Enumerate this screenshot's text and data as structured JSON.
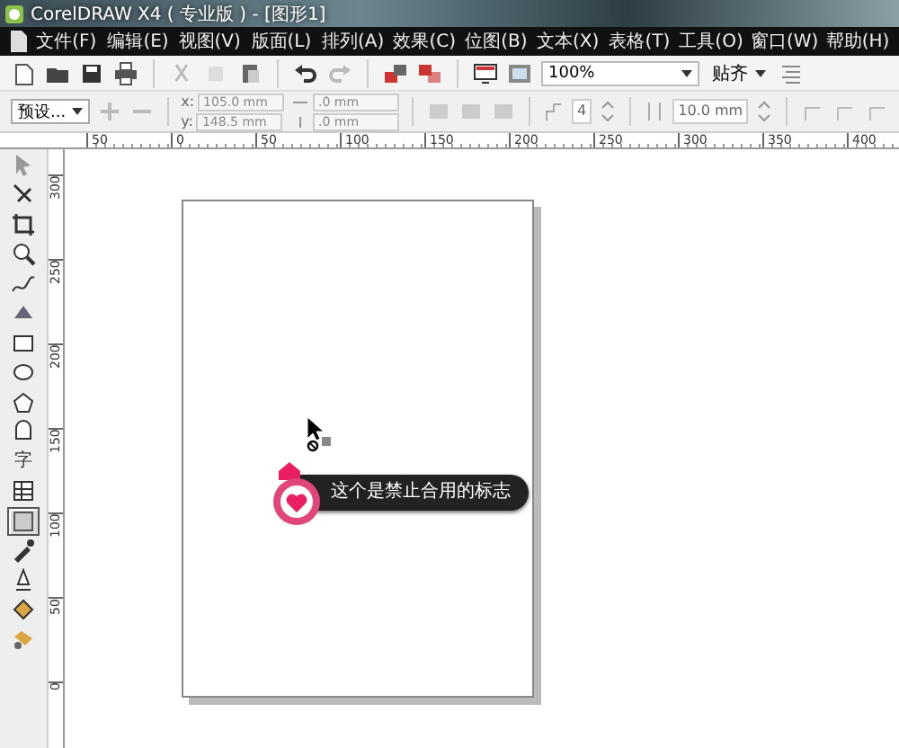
{
  "window": {
    "title": "CorelDRAW X4 ( 专业版 ) - [图形1]"
  },
  "menu": [
    "文件(F)",
    "编辑(E)",
    "视图(V)",
    "版面(L)",
    "排列(A)",
    "效果(C)",
    "位图(B)",
    "文本(X)",
    "表格(T)",
    "工具(O)",
    "窗口(W)",
    "帮助(H)"
  ],
  "toolbar": {
    "zoom": "100%",
    "snap": "贴齐"
  },
  "property_bar": {
    "preset": "预设...",
    "x_label": "x:",
    "x": "105.0 mm",
    "y_label": "y:",
    "y": "148.5 mm",
    "width": ".0 mm",
    "height": ".0 mm",
    "count": "4",
    "spacing": "10.0 mm"
  },
  "ruler": {
    "horizontal": [
      "50",
      "0",
      "50",
      "100",
      "150",
      "200",
      "250",
      "300",
      "350",
      "400"
    ],
    "vertical": [
      "300",
      "250",
      "200",
      "150",
      "100",
      "50",
      "0"
    ]
  },
  "toolbox": [
    {
      "kind": "pick",
      "selected": false
    },
    {
      "kind": "shape",
      "selected": false
    },
    {
      "kind": "crop",
      "selected": false
    },
    {
      "kind": "zoom",
      "selected": false
    },
    {
      "kind": "freehand",
      "selected": false
    },
    {
      "kind": "smart",
      "selected": false
    },
    {
      "kind": "rectangle",
      "selected": false
    },
    {
      "kind": "ellipse",
      "selected": false
    },
    {
      "kind": "polygon",
      "selected": false
    },
    {
      "kind": "basic",
      "selected": false
    },
    {
      "kind": "text",
      "label": "字",
      "selected": false
    },
    {
      "kind": "table",
      "selected": false
    },
    {
      "kind": "interactive",
      "selected": true
    },
    {
      "kind": "eyedropper",
      "selected": false
    },
    {
      "kind": "outline",
      "selected": false
    },
    {
      "kind": "fill",
      "selected": false
    },
    {
      "kind": "meshfill",
      "selected": false
    }
  ],
  "tooltip": {
    "text": "这个是禁止合用的标志"
  }
}
